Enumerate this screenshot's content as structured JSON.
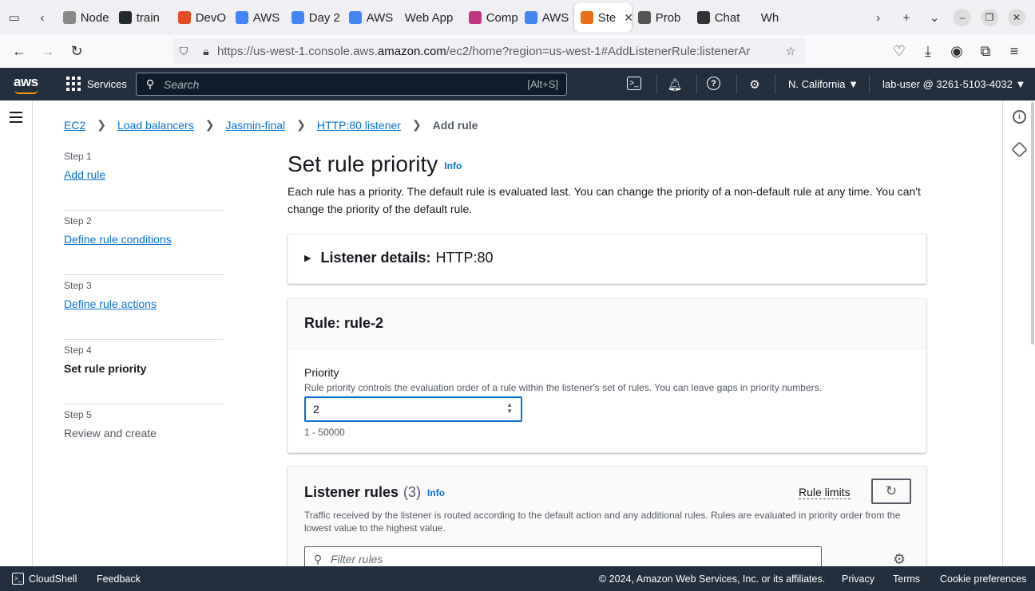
{
  "browser": {
    "tabs": [
      {
        "label": "Node Ex",
        "icon": "page-icon",
        "color": "#888888"
      },
      {
        "label": "train",
        "icon": "github-icon",
        "color": "#24292f"
      },
      {
        "label": "DevO",
        "icon": "shapes-icon",
        "color": "#e44d26"
      },
      {
        "label": "AWS",
        "icon": "doc-icon",
        "color": "#4285f4"
      },
      {
        "label": "Day 2",
        "icon": "doc-icon",
        "color": "#4285f4"
      },
      {
        "label": "AWS",
        "icon": "doc-icon",
        "color": "#4285f4"
      },
      {
        "label": "Web App",
        "icon": "none",
        "color": "#ffffff"
      },
      {
        "label": "Comp",
        "icon": "cube-icon",
        "color": "#c13584"
      },
      {
        "label": "AWS",
        "icon": "doc-icon",
        "color": "#4285f4"
      },
      {
        "label": "Ste",
        "icon": "aws-stepfunctions-icon",
        "color": "#e7711b",
        "active": true
      },
      {
        "label": "Prob",
        "icon": "info-icon",
        "color": "#555555"
      },
      {
        "label": "Chat",
        "icon": "openai-icon",
        "color": "#333333"
      },
      {
        "label": "Wh",
        "icon": "none",
        "color": "#ffffff"
      }
    ],
    "url_host_prefix": "https://us-west-1.console.aws.",
    "url_host_main": "amazon.com",
    "url_path": "/ec2/home?region=us-west-1#AddListenerRule:listenerAr"
  },
  "aws_header": {
    "logo": "aws",
    "services_label": "Services",
    "search_placeholder": "Search",
    "search_shortcut": "[Alt+S]",
    "region": "N. California",
    "account": "lab-user @ 3261-5103-4032"
  },
  "breadcrumb": {
    "items": [
      "EC2",
      "Load balancers",
      "Jasmin-final",
      "HTTP:80 listener"
    ],
    "current": "Add rule"
  },
  "steps": [
    {
      "step": "Step 1",
      "label": "Add rule",
      "state": "link"
    },
    {
      "step": "Step 2",
      "label": "Define rule conditions",
      "state": "link"
    },
    {
      "step": "Step 3",
      "label": "Define rule actions",
      "state": "link"
    },
    {
      "step": "Step 4",
      "label": "Set rule priority",
      "state": "current"
    },
    {
      "step": "Step 5",
      "label": "Review and create",
      "state": "disabled"
    }
  ],
  "page": {
    "title": "Set rule priority",
    "info": "Info",
    "description": "Each rule has a priority. The default rule is evaluated last. You can change the priority of a non-default rule at any time. You can't change the priority of the default rule."
  },
  "listener_details": {
    "label": "Listener details:",
    "value": "HTTP:80"
  },
  "rule": {
    "heading": "Rule: rule-2",
    "priority_label": "Priority",
    "priority_description": "Rule priority controls the evaluation order of a rule within the listener's set of rules. You can leave gaps in priority numbers.",
    "priority_value": "2",
    "priority_hint": "1 - 50000"
  },
  "listener_rules": {
    "title": "Listener rules",
    "count": "(3)",
    "info": "Info",
    "rule_limits": "Rule limits",
    "description": "Traffic received by the listener is routed according to the default action and any additional rules. Rules are evaluated in priority order from the lowest value to the highest value.",
    "filter_placeholder": "Filter rules"
  },
  "footer": {
    "cloudshell": "CloudShell",
    "feedback": "Feedback",
    "copyright": "© 2024, Amazon Web Services, Inc. or its affiliates.",
    "privacy": "Privacy",
    "terms": "Terms",
    "cookie": "Cookie preferences"
  },
  "colors": {
    "link": "#0972d3",
    "header_bg": "#232f3e",
    "brand_orange": "#ff9900"
  }
}
